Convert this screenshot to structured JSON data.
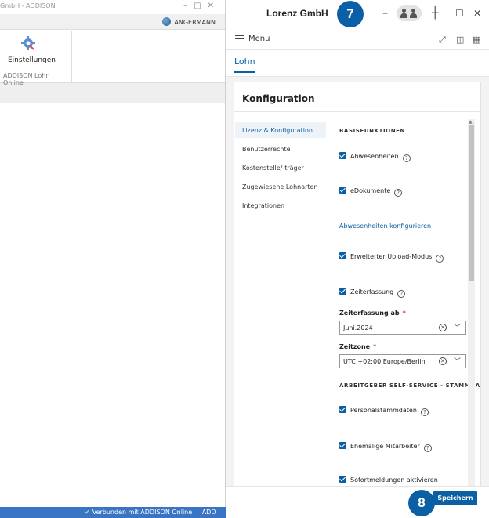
{
  "left_window": {
    "title": "GmbH - ADDISON",
    "user_name": "ANGERMANN",
    "ribbon_button": "Einstellungen",
    "ribbon_group": "ADDISON Lohn Online",
    "status_text": "Verbunden mit ADDISON Online",
    "status_extra": "ADD"
  },
  "app": {
    "company": "Lorenz GmbH",
    "step_badge_top": "7",
    "step_badge_bottom": "8",
    "menu_label": "Menu",
    "tab_label": "Lohn",
    "card_title": "Konfiguration",
    "nav_items": [
      "Lizenz & Konfiguration",
      "Benutzerrechte",
      "Kostenstelle/-träger",
      "Zugewiesene Lohnarten",
      "Integrationen"
    ],
    "section_basis": "BASISFUNKTIONEN",
    "cb_abwesenheiten": "Abwesenheiten",
    "cb_edokumente": "eDokumente",
    "link_abwesenheiten": "Abwesenheiten konfigurieren",
    "cb_upload": "Erweiterter Upload-Modus",
    "cb_zeiterfassung": "Zeiterfassung",
    "label_zeiterfassung_ab": "Zeiterfassung ab",
    "value_zeiterfassung_ab": "Juni.2024",
    "label_zeitzone": "Zeitzone",
    "value_zeitzone": "UTC +02:00 Europe/Berlin",
    "section_ess": "ARBEITGEBER SELF-SERVICE - STAMMDATEN",
    "cb_personal": "Personalstammdaten",
    "cb_ehemalige": "Ehemalige Mitarbeiter",
    "cb_sofort": "Sofortmeldungen aktivieren",
    "save_label": "Speichern",
    "required_mark": "*",
    "help_glyph": "?",
    "accent_color": "#0b5fa5"
  }
}
